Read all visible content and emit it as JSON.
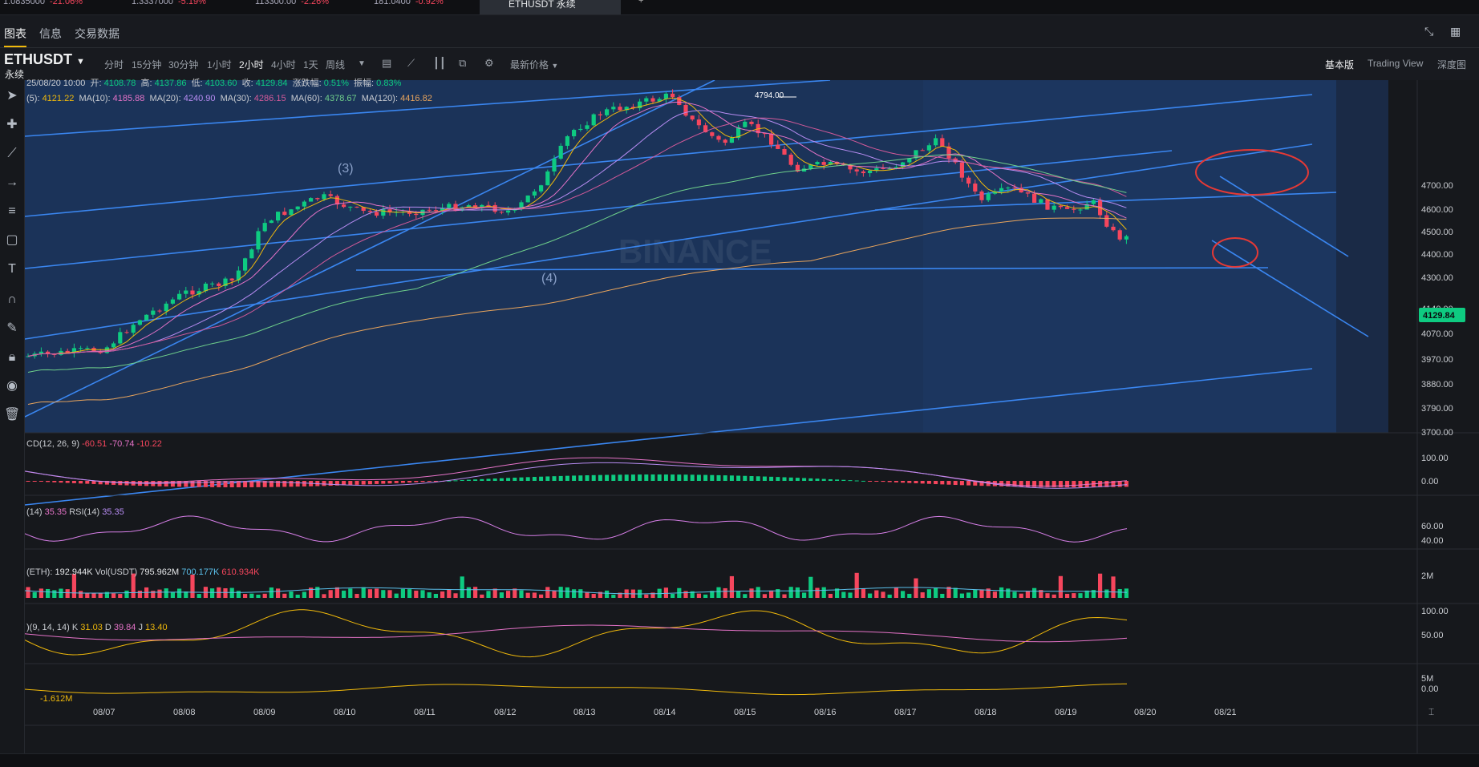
{
  "top_tickers": [
    {
      "price": "1.0835000",
      "change": "-21.06%"
    },
    {
      "price": "1.3337000",
      "change": "-5.19%"
    },
    {
      "price": "113300.00",
      "change": "-2.26%"
    },
    {
      "price": "181.0400",
      "change": "-0.92%"
    }
  ],
  "active_tab": "ETHUSDT 永续",
  "header": {
    "tabs": [
      "图表",
      "信息",
      "交易数据"
    ],
    "active": "图表"
  },
  "toolbar": {
    "symbol": "ETHUSDT",
    "symbol_sub": "永续",
    "timeframes": [
      "分时",
      "15分钟",
      "30分钟",
      "1小时",
      "2小时",
      "4小时",
      "1天",
      "周线"
    ],
    "active_timeframe": "2小时",
    "price_type": "最新价格",
    "views": [
      "基本版",
      "Trading View",
      "深度图"
    ],
    "active_view": "基本版"
  },
  "left_tools": [
    "cursor-icon",
    "crosshair-icon",
    "trendline-icon",
    "arrow-icon",
    "fib-icon",
    "rectangle-icon",
    "text-icon",
    "magnet-icon",
    "pencil-icon",
    "lock-icon",
    "eye-icon",
    "trash-icon"
  ],
  "ohlc": {
    "date": "25/08/20 10:00",
    "open_label": "开:",
    "open": "4108.78",
    "high_label": "高:",
    "high": "4137.86",
    "low_label": "低:",
    "low": "4103.60",
    "close_label": "收:",
    "close": "4129.84",
    "change_label": "涨跌幅:",
    "change": "0.51%",
    "amp_label": "振幅:",
    "amp": "0.83%"
  },
  "ma": [
    {
      "label": "(5):",
      "value": "4121.22",
      "color": "#f0b90b"
    },
    {
      "label": "MA(10):",
      "value": "4185.88",
      "color": "#e573c8"
    },
    {
      "label": "MA(20):",
      "value": "4240.90",
      "color": "#b78cf2"
    },
    {
      "label": "MA(30):",
      "value": "4286.15",
      "color": "#d45a9a"
    },
    {
      "label": "MA(60):",
      "value": "4378.67",
      "color": "#6fd08b"
    },
    {
      "label": "MA(120):",
      "value": "4416.82",
      "color": "#e8a45c"
    }
  ],
  "price_axis": [
    "4700.00",
    "4600.00",
    "4500.00",
    "4400.00",
    "4300.00",
    "4140.00",
    "4070.00",
    "3970.00",
    "3880.00",
    "3790.00",
    "3700.00"
  ],
  "current_price": "4129.84",
  "peak_label": "4794.00",
  "wave_labels": [
    "(3)",
    "(4)"
  ],
  "watermark": "BINANCE",
  "macd": {
    "label": "CD(12, 26, 9)",
    "v1": "-60.51",
    "v2": "-70.74",
    "v3": "-10.22",
    "axis": [
      "100.00",
      "0.00"
    ]
  },
  "rsi": {
    "label": "(14)",
    "v1": "35.35",
    "label2": "RSI(14)",
    "v2": "35.35",
    "axis": [
      "60.00",
      "40.00"
    ]
  },
  "vol": {
    "label": "(ETH):",
    "v1": "192.944K",
    "label2": "Vol(USDT)",
    "v2": "795.962M",
    "v3": "700.177K",
    "v4": "610.934K",
    "axis": [
      "2M"
    ]
  },
  "kdj": {
    "label": ")(9, 14, 14)",
    "k_label": "K",
    "k": "31.03",
    "d_label": "D",
    "d": "39.84",
    "j_label": "J",
    "j": "13.40",
    "axis": [
      "100.00",
      "50.00"
    ]
  },
  "obv": {
    "value": "-1.612M",
    "axis": [
      "5M",
      "0.00"
    ]
  },
  "dates": [
    "08/07",
    "08/08",
    "08/09",
    "08/10",
    "08/11",
    "08/12",
    "08/13",
    "08/14",
    "08/15",
    "08/16",
    "08/17",
    "08/18",
    "08/19",
    "08/20",
    "08/21"
  ],
  "colors": {
    "up": "#0ecb81",
    "down": "#f6465d",
    "accent": "#f0b90b",
    "channel": "#3a7fe0"
  }
}
